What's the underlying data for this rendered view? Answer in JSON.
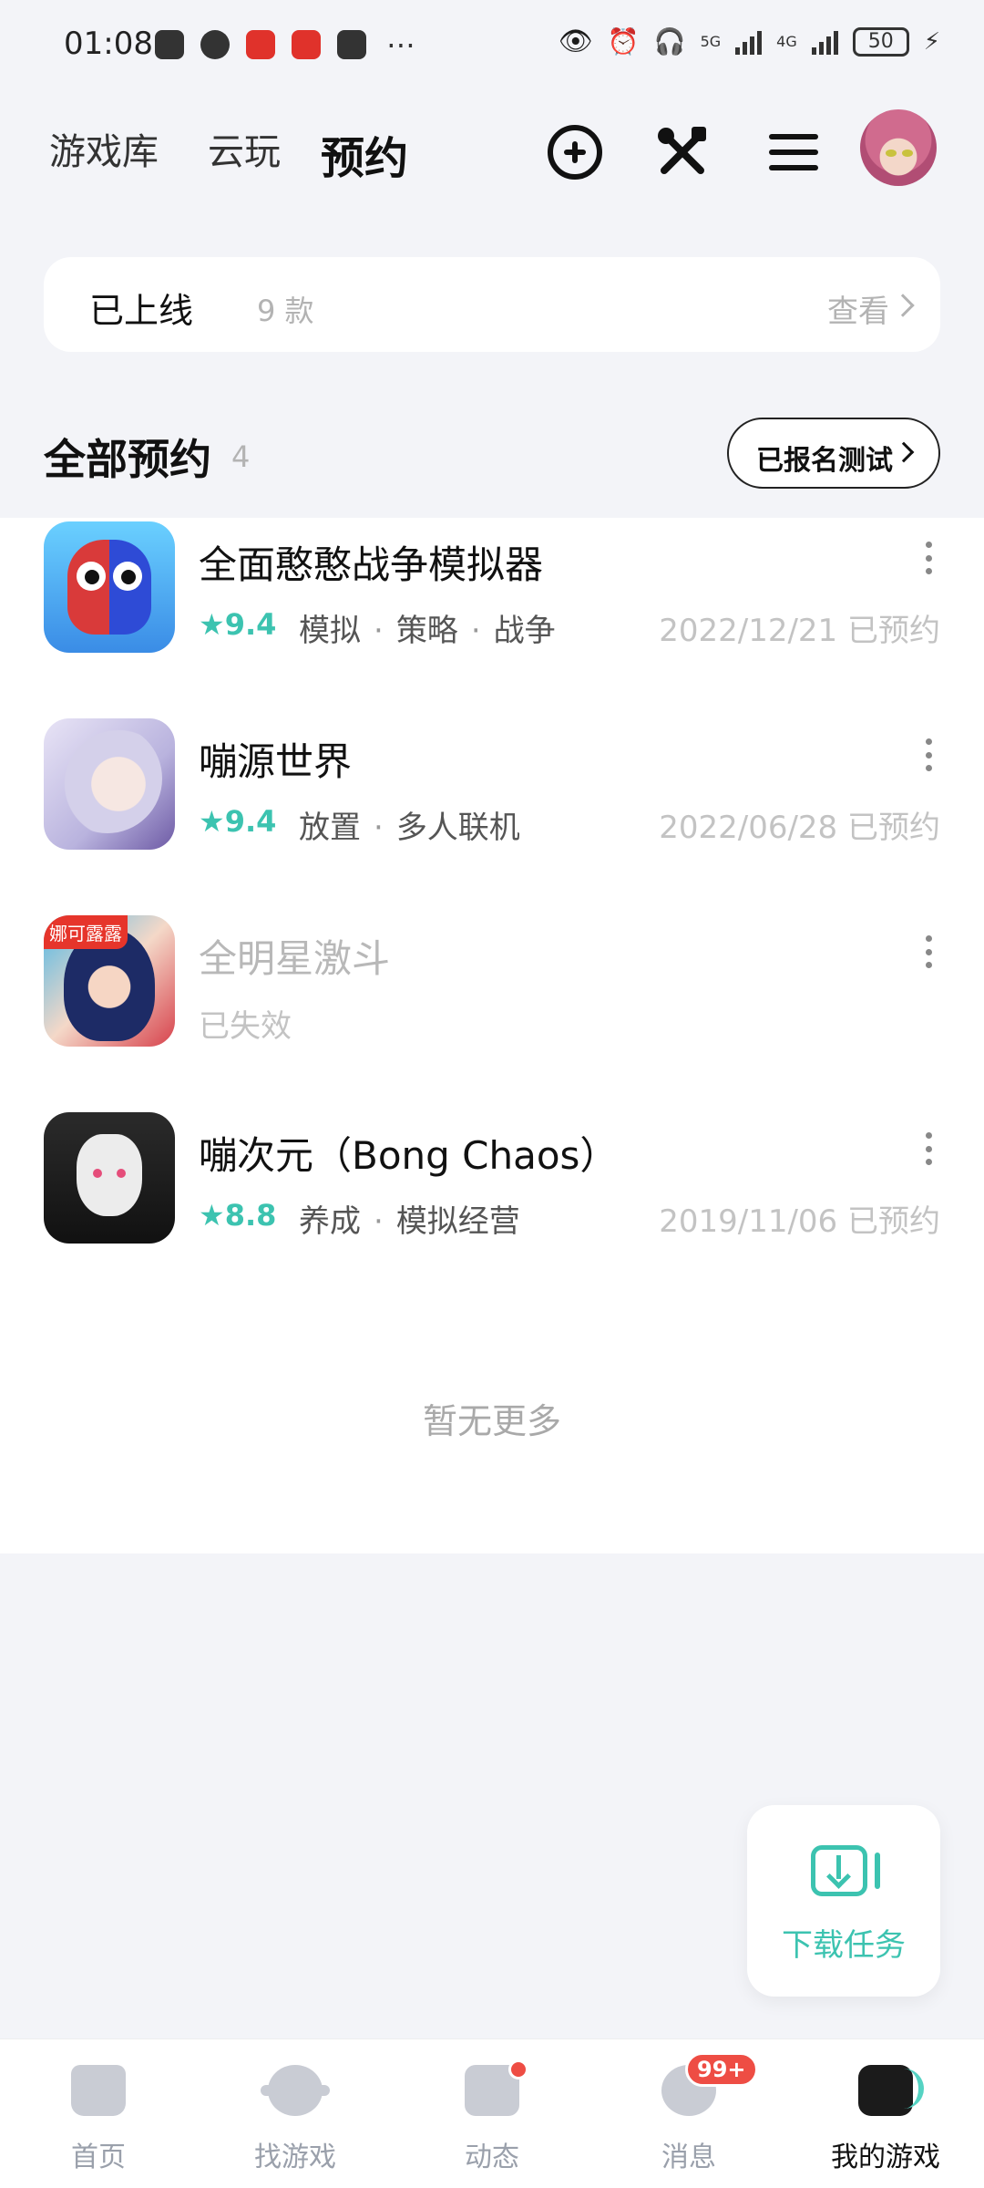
{
  "status_bar": {
    "time": "01:08",
    "network1": "5G",
    "network2": "4G",
    "battery": "50"
  },
  "top_nav": {
    "tabs": [
      "游戏库",
      "云玩",
      "预约"
    ],
    "active_tab": "预约"
  },
  "online": {
    "label": "已上线",
    "count": "9 款",
    "view": "查看"
  },
  "section": {
    "title": "全部预约",
    "count": "4",
    "test_button": "已报名测试"
  },
  "games": [
    {
      "name": "全面憨憨战争模拟器",
      "rating": "9.4",
      "tags": [
        "模拟",
        "策略",
        "战争"
      ],
      "date": "2022/12/21 已预约"
    },
    {
      "name": "嘣源世界",
      "rating": "9.4",
      "tags": [
        "放置",
        "多人联机"
      ],
      "date": "2022/06/28 已预约"
    },
    {
      "name": "全明星激斗",
      "status": "已失效",
      "icon_badge": "娜可露露"
    },
    {
      "name": "嘣次元（Bong Chaos）",
      "rating": "8.8",
      "tags": [
        "养成",
        "模拟经营"
      ],
      "date": "2019/11/06 已预约"
    }
  ],
  "no_more": "暂无更多",
  "download_task": "下载任务",
  "tab_bar": {
    "items": [
      "首页",
      "找游戏",
      "动态",
      "消息",
      "我的游戏"
    ],
    "active": "我的游戏",
    "message_badge": "99+"
  },
  "colors": {
    "accent": "#3cc3b0",
    "highlight": "#55d3c3",
    "badge_red": "#ee4d44"
  }
}
